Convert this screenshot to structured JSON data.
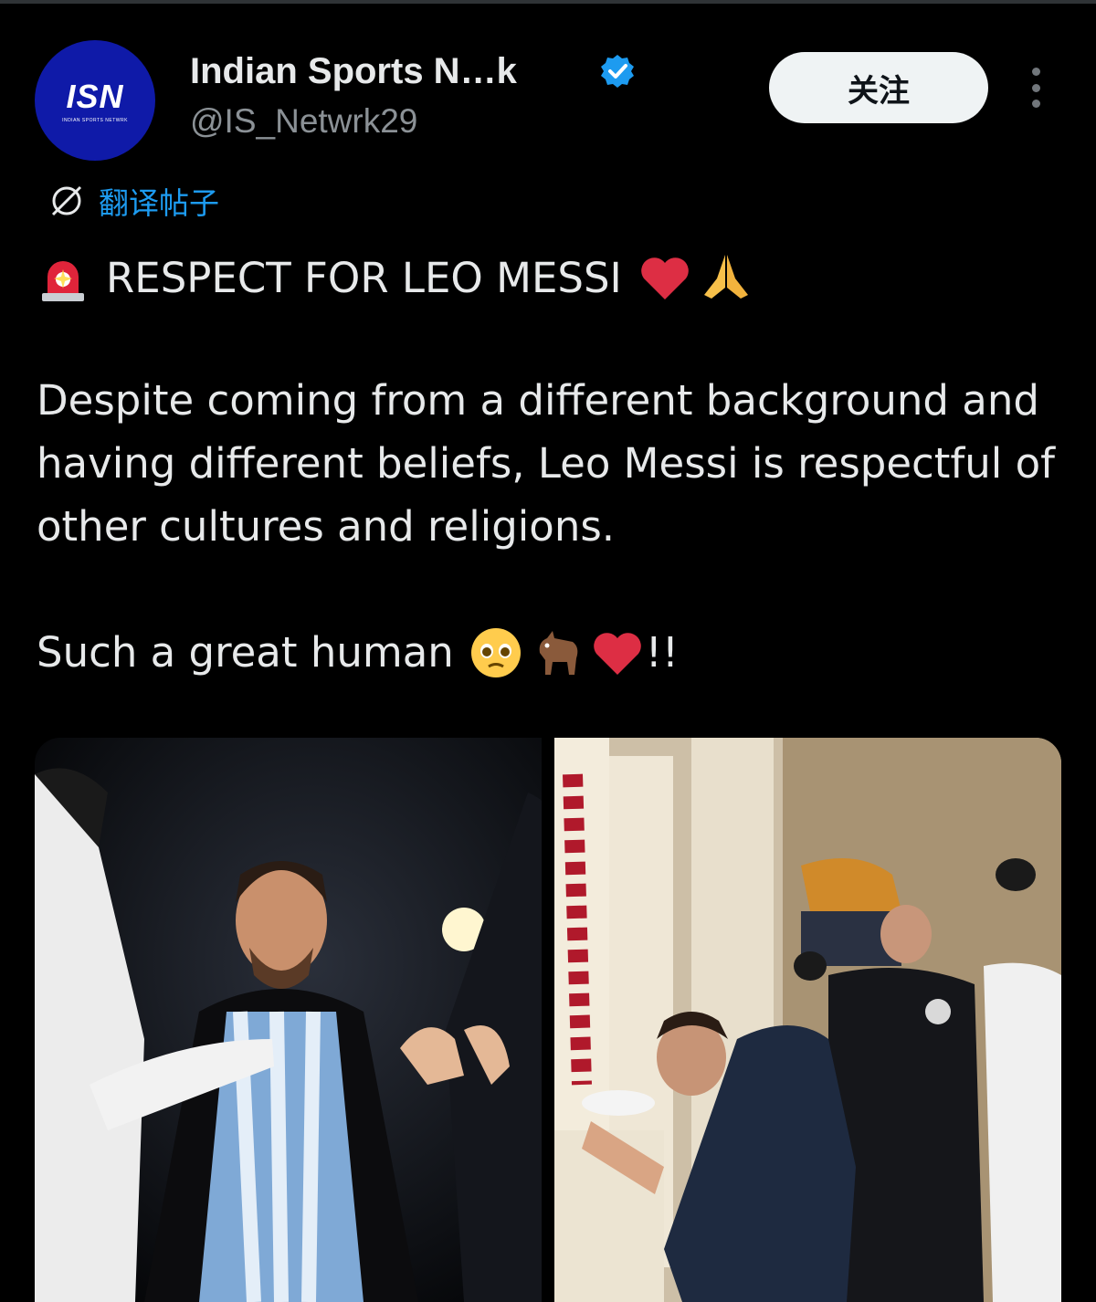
{
  "account": {
    "display_name": "Indian Sports N…k",
    "handle": "@IS_Netwrk29",
    "avatar_logo": "ISN",
    "avatar_subtext": "INDIAN SPORTS NETWRK",
    "verified": true
  },
  "follow_label": "关注",
  "translate_label": "翻译帖子",
  "post": {
    "headline": "RESPECT FOR LEO MESSI",
    "body": "Despite coming from a different background and having different beliefs, Leo Messi is respectful of other cultures and religions.",
    "closing": "Such a great human",
    "closing_suffix": "!!"
  },
  "icons": {
    "headline_lead": "siren-icon",
    "headline_trail": [
      "heart-icon",
      "praying-hands-icon"
    ],
    "closing_trail": [
      "pleading-face-icon",
      "goat-icon",
      "heart-icon"
    ]
  },
  "colors": {
    "background": "#000000",
    "text": "#e7e9ea",
    "muted": "#71767b",
    "link": "#1d9bf0",
    "verified": "#1d9bf0",
    "avatar": "#0f1aa8"
  }
}
